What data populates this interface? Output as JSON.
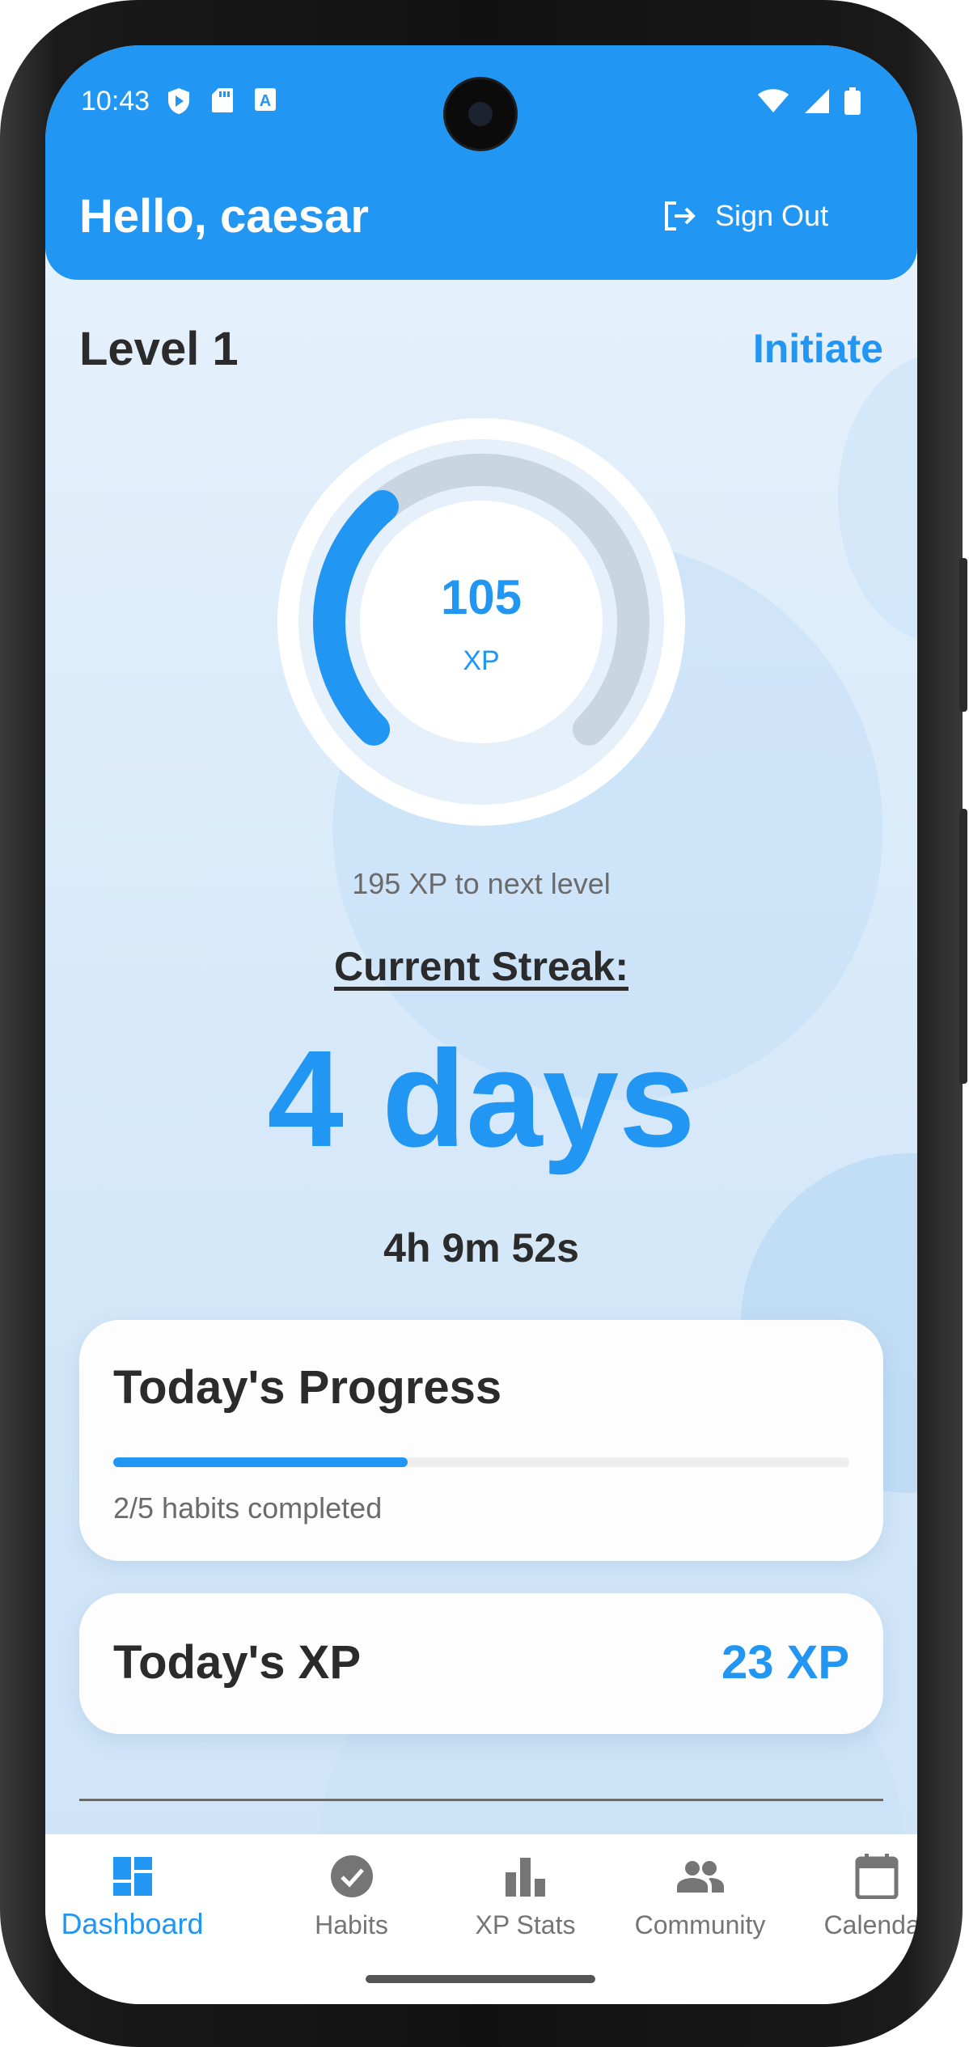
{
  "status_bar": {
    "time": "10:43",
    "left_icons": [
      "shield-play-icon",
      "sd-card-icon",
      "text-a-icon"
    ],
    "right_icons": [
      "wifi-icon",
      "cell-signal-icon",
      "battery-icon"
    ]
  },
  "header": {
    "greeting": "Hello, caesar",
    "sign_out_label": "Sign Out",
    "sign_out_icon": "logout-icon",
    "background_color": "#2196f3"
  },
  "level": {
    "title": "Level 1",
    "rank": "Initiate"
  },
  "xp_gauge": {
    "value": "105",
    "unit": "XP",
    "progress_fraction": 0.35,
    "next_level_text": "195 XP to next level"
  },
  "streak": {
    "label": "Current Streak:",
    "days": "4 days",
    "timer": "4h 9m 52s"
  },
  "todays_progress": {
    "title": "Today's Progress",
    "completed": 2,
    "total": 5,
    "fraction": 0.4,
    "text": "2/5 habits completed"
  },
  "todays_xp": {
    "title": "Today's XP",
    "value": "23 XP"
  },
  "bottom_nav": {
    "active_color": "#2196f3",
    "inactive_color": "#757575",
    "items": [
      {
        "label": "Dashboard",
        "icon": "dashboard-icon",
        "active": true
      },
      {
        "label": "Habits",
        "icon": "check-circle-icon",
        "active": false
      },
      {
        "label": "XP Stats",
        "icon": "bar-chart-icon",
        "active": false
      },
      {
        "label": "Community",
        "icon": "people-icon",
        "active": false
      },
      {
        "label": "Calendar",
        "icon": "calendar-icon",
        "active": false
      }
    ]
  }
}
